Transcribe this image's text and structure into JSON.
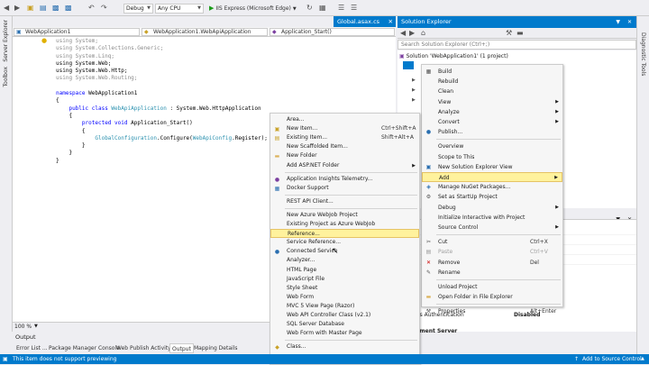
{
  "toolbar": {
    "config": "Debug",
    "platform": "Any CPU",
    "run_label": "IIS Express (Microsoft Edge)"
  },
  "left_sidebar": {
    "server_explorer": "Server Explorer",
    "toolbox": "Toolbox"
  },
  "right_sidebar": {
    "diagnostic_tools": "Diagnostic Tools"
  },
  "doc_tab": {
    "label": "Global.asax.cs"
  },
  "nav": {
    "project": "WebApplication1",
    "class": "WebApplication1.WebApiApplication",
    "member": "Application_Start()"
  },
  "code": {
    "l1": "using System;",
    "l2": "using System.Collections.Generic;",
    "l3": "using System.Linq;",
    "l4": "using System.Web;",
    "l5": "using System.Web.Http;",
    "l6": "using System.Web.Routing;",
    "ns_kw": "namespace",
    "ns_name": " WebApplication1",
    "ob1": "{",
    "cls_kw": "public class ",
    "cls_name": "WebApiApplication",
    "cls_base": " : System.Web.HttpApplication",
    "ob2": "{",
    "m_kw": "protected void ",
    "m_name": "Application_Start()",
    "ob3": "{",
    "stmt_a": "GlobalConfiguration",
    "stmt_b": ".Configure(",
    "stmt_c": "WebApiConfig",
    "stmt_d": ".Register);",
    "cb3": "}",
    "cb2": "}",
    "cb1": "}"
  },
  "zoom": "100 %",
  "output": {
    "title": "Output"
  },
  "bottom_tabs": [
    "Error List ...",
    "Package Manager Console",
    "Web Publish Activity",
    "Output",
    "Mapping Details"
  ],
  "status": {
    "left": "This item does not support previewing",
    "right": "Add to Source Control"
  },
  "solution_explorer": {
    "title": "Solution Explorer",
    "search_placeholder": "Search Solution Explorer (Ctrl+;)",
    "solution_label": "Solution 'WebApplication1' (1 project)"
  },
  "properties": {
    "row_label": "ows Authentication",
    "row_value": "Disabled",
    "section": "opment Server"
  },
  "context_menu": [
    {
      "label": "Build",
      "icon": "build-icon"
    },
    {
      "label": "Rebuild"
    },
    {
      "label": "Clean"
    },
    {
      "label": "View",
      "submenu": true
    },
    {
      "label": "Analyze",
      "submenu": true
    },
    {
      "label": "Convert",
      "submenu": true
    },
    {
      "label": "Publish...",
      "icon": "globe-icon"
    },
    {
      "sep": true
    },
    {
      "label": "Overview"
    },
    {
      "label": "Scope to This"
    },
    {
      "label": "New Solution Explorer View",
      "icon": "new-view-icon"
    },
    {
      "label": "Add",
      "submenu": true,
      "highlight": true
    },
    {
      "label": "Manage NuGet Packages...",
      "icon": "nuget-icon"
    },
    {
      "label": "Set as StartUp Project",
      "icon": "gear-icon"
    },
    {
      "label": "Debug",
      "submenu": true
    },
    {
      "label": "Initialize Interactive with Project"
    },
    {
      "label": "Source Control",
      "submenu": true
    },
    {
      "sep": true
    },
    {
      "label": "Cut",
      "shortcut": "Ctrl+X",
      "icon": "scissors-icon"
    },
    {
      "label": "Paste",
      "shortcut": "Ctrl+V",
      "icon": "paste-icon",
      "disabled": true
    },
    {
      "label": "Remove",
      "shortcut": "Del",
      "icon": "remove-icon"
    },
    {
      "label": "Rename",
      "icon": "rename-icon"
    },
    {
      "sep": true
    },
    {
      "label": "Unload Project"
    },
    {
      "label": "Open Folder in File Explorer",
      "icon": "folder-icon"
    },
    {
      "sep": true
    },
    {
      "label": "Properties",
      "shortcut": "Alt+Enter",
      "icon": "wrench-icon"
    }
  ],
  "add_submenu": [
    {
      "label": "Area..."
    },
    {
      "label": "New Item...",
      "shortcut": "Ctrl+Shift+A",
      "icon": "new-item-icon"
    },
    {
      "label": "Existing Item...",
      "shortcut": "Shift+Alt+A",
      "icon": "existing-item-icon"
    },
    {
      "label": "New Scaffolded Item..."
    },
    {
      "label": "New Folder",
      "icon": "folder-icon"
    },
    {
      "label": "Add ASP.NET Folder",
      "submenu": true
    },
    {
      "sep": true
    },
    {
      "label": "Application Insights Telemetry...",
      "icon": "insights-icon"
    },
    {
      "label": "Docker Support",
      "icon": "docker-icon"
    },
    {
      "sep": true
    },
    {
      "label": "REST API Client..."
    },
    {
      "sep": true
    },
    {
      "label": "New Azure WebJob Project"
    },
    {
      "label": "Existing Project as Azure WebJob"
    },
    {
      "label": "Reference...",
      "highlight": true
    },
    {
      "label": "Service Reference..."
    },
    {
      "label": "Connected Service",
      "icon": "connected-icon"
    },
    {
      "label": "Analyzer..."
    },
    {
      "label": "HTML Page"
    },
    {
      "label": "JavaScript File"
    },
    {
      "label": "Style Sheet"
    },
    {
      "label": "Web Form"
    },
    {
      "label": "MVC 5 View Page (Razor)"
    },
    {
      "label": "Web API Controller Class (v2.1)"
    },
    {
      "label": "SQL Server Database"
    },
    {
      "label": "Web Form with Master Page"
    },
    {
      "sep": true
    },
    {
      "label": "Class...",
      "icon": "class-icon"
    }
  ]
}
